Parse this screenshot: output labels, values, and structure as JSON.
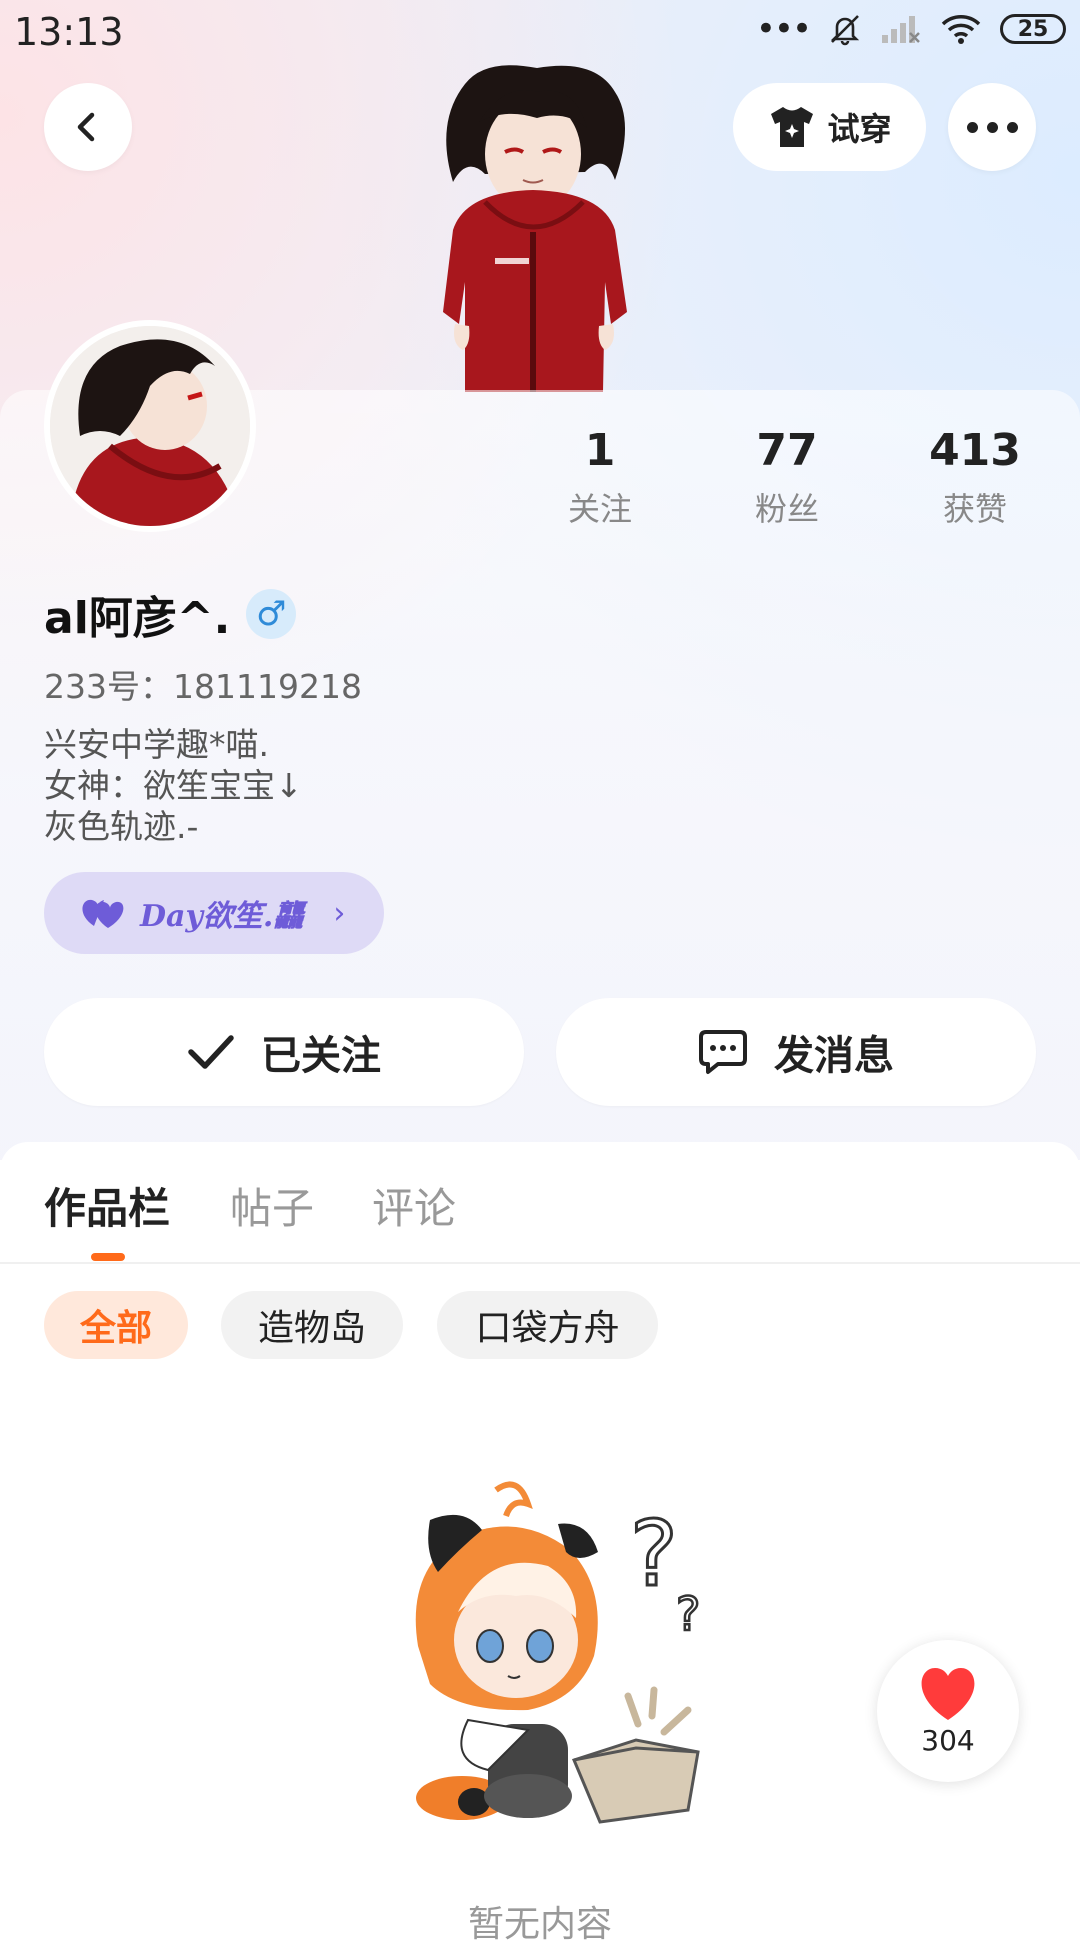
{
  "status_bar": {
    "time": "13:13",
    "more": "•••",
    "battery": "25"
  },
  "header": {
    "try_on_label": "试穿"
  },
  "stats": [
    {
      "value": "1",
      "label": "关注"
    },
    {
      "value": "77",
      "label": "粉丝"
    },
    {
      "value": "413",
      "label": "获赞"
    }
  ],
  "profile": {
    "name": "al阿彦^.",
    "gender_icon": "♂",
    "uid": "233号：181119218",
    "bio": [
      "兴安中学趣*喵.",
      "女神：欲笙宝宝↓",
      "灰色轨迹.-"
    ],
    "couple_name": "Day欲笙.龘"
  },
  "actions": {
    "follow_label": "已关注",
    "message_label": "发消息"
  },
  "tabs": [
    {
      "label": "作品栏",
      "active": true
    },
    {
      "label": "帖子",
      "active": false
    },
    {
      "label": "评论",
      "active": false
    }
  ],
  "filters": [
    {
      "label": "全部",
      "active": true
    },
    {
      "label": "造物岛",
      "active": false
    },
    {
      "label": "口袋方舟",
      "active": false
    }
  ],
  "empty_state": {
    "text": "暂无内容"
  },
  "like_fab": {
    "count": "304"
  },
  "colors": {
    "accent": "#ff6a1a",
    "couple": "#6e5cd8",
    "male": "#2f8bd8",
    "heart": "#ff3b3b"
  }
}
